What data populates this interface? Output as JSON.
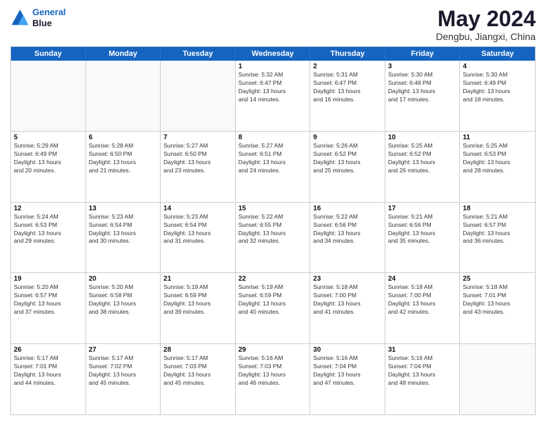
{
  "logo": {
    "line1": "General",
    "line2": "Blue"
  },
  "title": "May 2024",
  "location": "Dengbu, Jiangxi, China",
  "days_of_week": [
    "Sunday",
    "Monday",
    "Tuesday",
    "Wednesday",
    "Thursday",
    "Friday",
    "Saturday"
  ],
  "weeks": [
    [
      {
        "day": "",
        "info": ""
      },
      {
        "day": "",
        "info": ""
      },
      {
        "day": "",
        "info": ""
      },
      {
        "day": "1",
        "info": "Sunrise: 5:32 AM\nSunset: 6:47 PM\nDaylight: 13 hours\nand 14 minutes."
      },
      {
        "day": "2",
        "info": "Sunrise: 5:31 AM\nSunset: 6:47 PM\nDaylight: 13 hours\nand 16 minutes."
      },
      {
        "day": "3",
        "info": "Sunrise: 5:30 AM\nSunset: 6:48 PM\nDaylight: 13 hours\nand 17 minutes."
      },
      {
        "day": "4",
        "info": "Sunrise: 5:30 AM\nSunset: 6:49 PM\nDaylight: 13 hours\nand 18 minutes."
      }
    ],
    [
      {
        "day": "5",
        "info": "Sunrise: 5:29 AM\nSunset: 6:49 PM\nDaylight: 13 hours\nand 20 minutes."
      },
      {
        "day": "6",
        "info": "Sunrise: 5:28 AM\nSunset: 6:50 PM\nDaylight: 13 hours\nand 21 minutes."
      },
      {
        "day": "7",
        "info": "Sunrise: 5:27 AM\nSunset: 6:50 PM\nDaylight: 13 hours\nand 23 minutes."
      },
      {
        "day": "8",
        "info": "Sunrise: 5:27 AM\nSunset: 6:51 PM\nDaylight: 13 hours\nand 24 minutes."
      },
      {
        "day": "9",
        "info": "Sunrise: 5:26 AM\nSunset: 6:52 PM\nDaylight: 13 hours\nand 25 minutes."
      },
      {
        "day": "10",
        "info": "Sunrise: 5:25 AM\nSunset: 6:52 PM\nDaylight: 13 hours\nand 26 minutes."
      },
      {
        "day": "11",
        "info": "Sunrise: 5:25 AM\nSunset: 6:53 PM\nDaylight: 13 hours\nand 28 minutes."
      }
    ],
    [
      {
        "day": "12",
        "info": "Sunrise: 5:24 AM\nSunset: 6:53 PM\nDaylight: 13 hours\nand 29 minutes."
      },
      {
        "day": "13",
        "info": "Sunrise: 5:23 AM\nSunset: 6:54 PM\nDaylight: 13 hours\nand 30 minutes."
      },
      {
        "day": "14",
        "info": "Sunrise: 5:23 AM\nSunset: 6:54 PM\nDaylight: 13 hours\nand 31 minutes."
      },
      {
        "day": "15",
        "info": "Sunrise: 5:22 AM\nSunset: 6:55 PM\nDaylight: 13 hours\nand 32 minutes."
      },
      {
        "day": "16",
        "info": "Sunrise: 5:22 AM\nSunset: 6:56 PM\nDaylight: 13 hours\nand 34 minutes."
      },
      {
        "day": "17",
        "info": "Sunrise: 5:21 AM\nSunset: 6:56 PM\nDaylight: 13 hours\nand 35 minutes."
      },
      {
        "day": "18",
        "info": "Sunrise: 5:21 AM\nSunset: 6:57 PM\nDaylight: 13 hours\nand 36 minutes."
      }
    ],
    [
      {
        "day": "19",
        "info": "Sunrise: 5:20 AM\nSunset: 6:57 PM\nDaylight: 13 hours\nand 37 minutes."
      },
      {
        "day": "20",
        "info": "Sunrise: 5:20 AM\nSunset: 6:58 PM\nDaylight: 13 hours\nand 38 minutes."
      },
      {
        "day": "21",
        "info": "Sunrise: 5:19 AM\nSunset: 6:59 PM\nDaylight: 13 hours\nand 39 minutes."
      },
      {
        "day": "22",
        "info": "Sunrise: 5:19 AM\nSunset: 6:59 PM\nDaylight: 13 hours\nand 40 minutes."
      },
      {
        "day": "23",
        "info": "Sunrise: 5:18 AM\nSunset: 7:00 PM\nDaylight: 13 hours\nand 41 minutes."
      },
      {
        "day": "24",
        "info": "Sunrise: 5:18 AM\nSunset: 7:00 PM\nDaylight: 13 hours\nand 42 minutes."
      },
      {
        "day": "25",
        "info": "Sunrise: 5:18 AM\nSunset: 7:01 PM\nDaylight: 13 hours\nand 43 minutes."
      }
    ],
    [
      {
        "day": "26",
        "info": "Sunrise: 5:17 AM\nSunset: 7:01 PM\nDaylight: 13 hours\nand 44 minutes."
      },
      {
        "day": "27",
        "info": "Sunrise: 5:17 AM\nSunset: 7:02 PM\nDaylight: 13 hours\nand 45 minutes."
      },
      {
        "day": "28",
        "info": "Sunrise: 5:17 AM\nSunset: 7:03 PM\nDaylight: 13 hours\nand 45 minutes."
      },
      {
        "day": "29",
        "info": "Sunrise: 5:16 AM\nSunset: 7:03 PM\nDaylight: 13 hours\nand 46 minutes."
      },
      {
        "day": "30",
        "info": "Sunrise: 5:16 AM\nSunset: 7:04 PM\nDaylight: 13 hours\nand 47 minutes."
      },
      {
        "day": "31",
        "info": "Sunrise: 5:16 AM\nSunset: 7:04 PM\nDaylight: 13 hours\nand 48 minutes."
      },
      {
        "day": "",
        "info": ""
      }
    ]
  ]
}
